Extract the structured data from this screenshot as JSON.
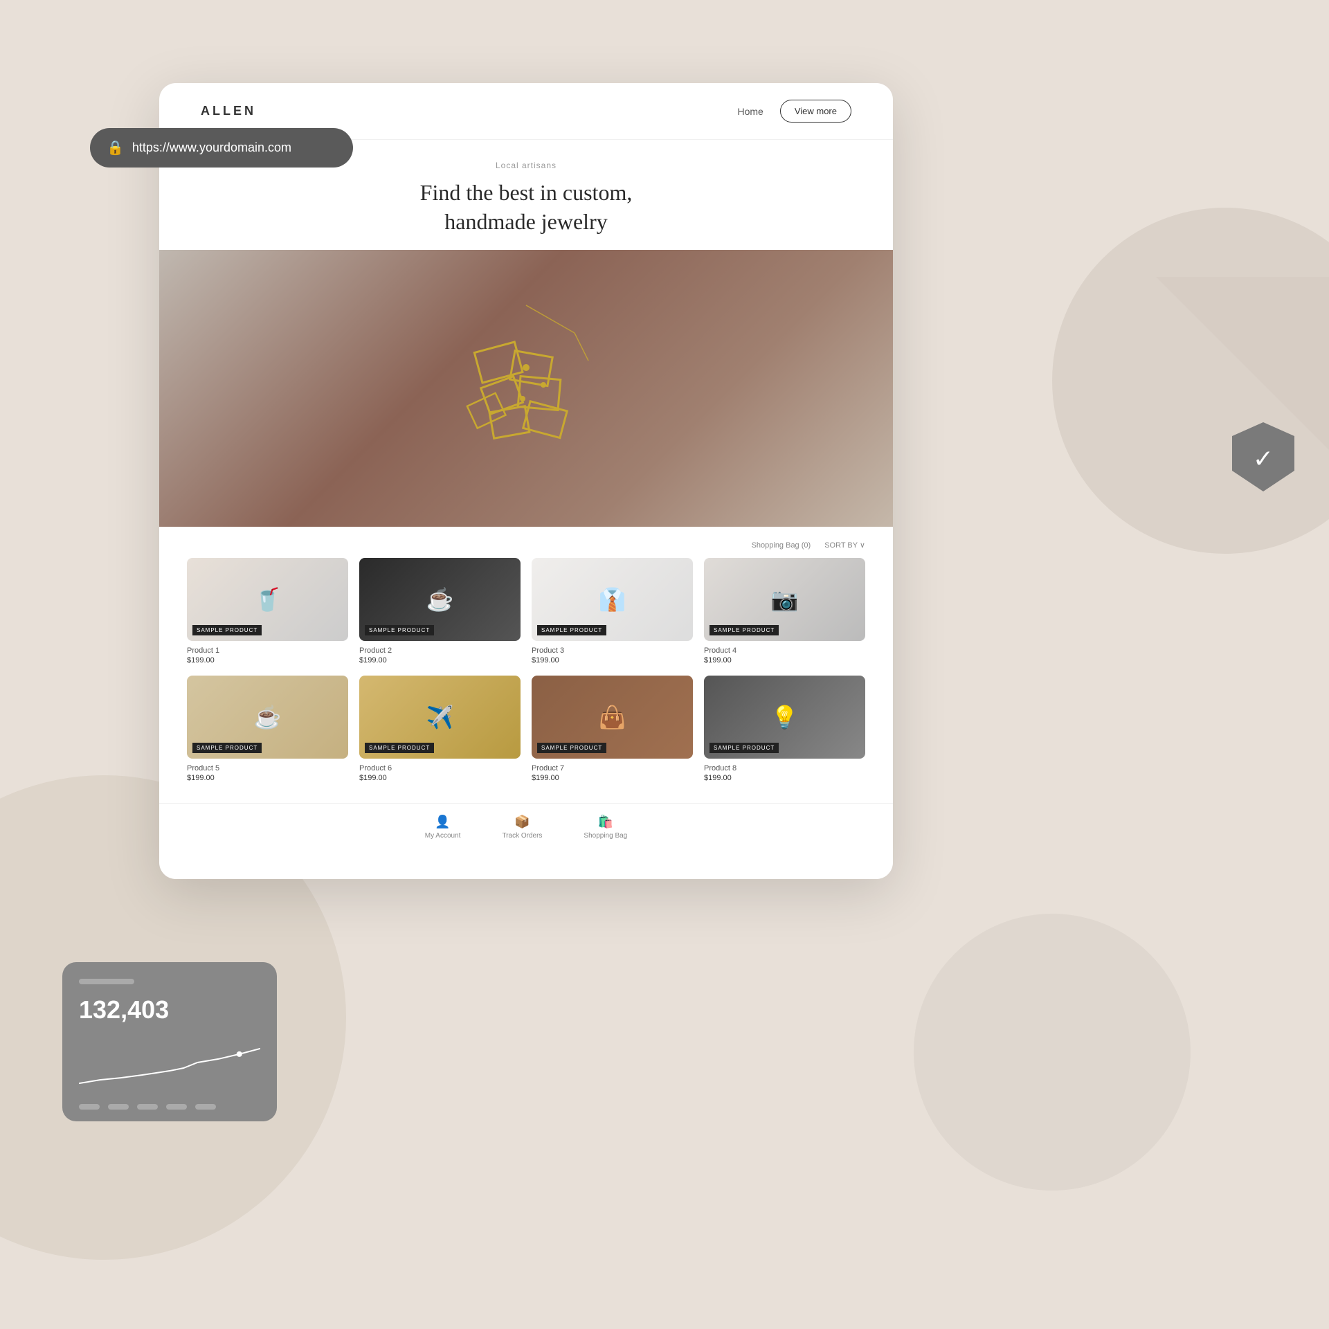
{
  "background": {
    "color": "#e8e0d8"
  },
  "url_bar": {
    "url": "https://www.yourdomain.com",
    "lock_icon": "🔒"
  },
  "nav": {
    "logo": "ALLEN",
    "home_link": "Home",
    "view_more_btn": "View more"
  },
  "hero": {
    "subtitle": "Local artisans",
    "title_line1": "Find the best in custom,",
    "title_line2": "handmade jewelry"
  },
  "products_header": {
    "bag_label": "Shopping Bag (0)",
    "sort_label": "SORT BY ∨"
  },
  "products": [
    {
      "id": 1,
      "name": "Product 1",
      "price": "$199.00",
      "badge": "SAMPLE PRODUCT",
      "icon": "🥤"
    },
    {
      "id": 2,
      "name": "Product 2",
      "price": "$199.00",
      "badge": "SAMPLE PRODUCT",
      "icon": "☕"
    },
    {
      "id": 3,
      "name": "Product 3",
      "price": "$199.00",
      "badge": "SAMPLE PRODUCT",
      "icon": "👔"
    },
    {
      "id": 4,
      "name": "Product 4",
      "price": "$199.00",
      "badge": "SAMPLE PRODUCT",
      "icon": "📷"
    },
    {
      "id": 5,
      "name": "Product 5",
      "price": "$199.00",
      "badge": "SAMPLE PRODUCT",
      "icon": "☕"
    },
    {
      "id": 6,
      "name": "Product 6",
      "price": "$199.00",
      "badge": "SAMPLE PRODUCT",
      "icon": "✈️"
    },
    {
      "id": 7,
      "name": "Product 7",
      "price": "$199.00",
      "badge": "SAMPLE PRODUCT",
      "icon": "👜"
    },
    {
      "id": 8,
      "name": "Product 8",
      "price": "$199.00",
      "badge": "SAMPLE PRODUCT",
      "icon": "💡"
    }
  ],
  "bottom_nav": [
    {
      "label": "My Account",
      "icon": "👤"
    },
    {
      "label": "Track Orders",
      "icon": "📦"
    },
    {
      "label": "Shopping Bag",
      "icon": "🛍️"
    }
  ],
  "stats_widget": {
    "number": "132,403"
  },
  "product_image_styles": [
    "prod-img-1",
    "prod-img-2",
    "prod-img-3",
    "prod-img-4",
    "prod-img-5",
    "prod-img-6",
    "prod-img-7",
    "prod-img-8"
  ]
}
